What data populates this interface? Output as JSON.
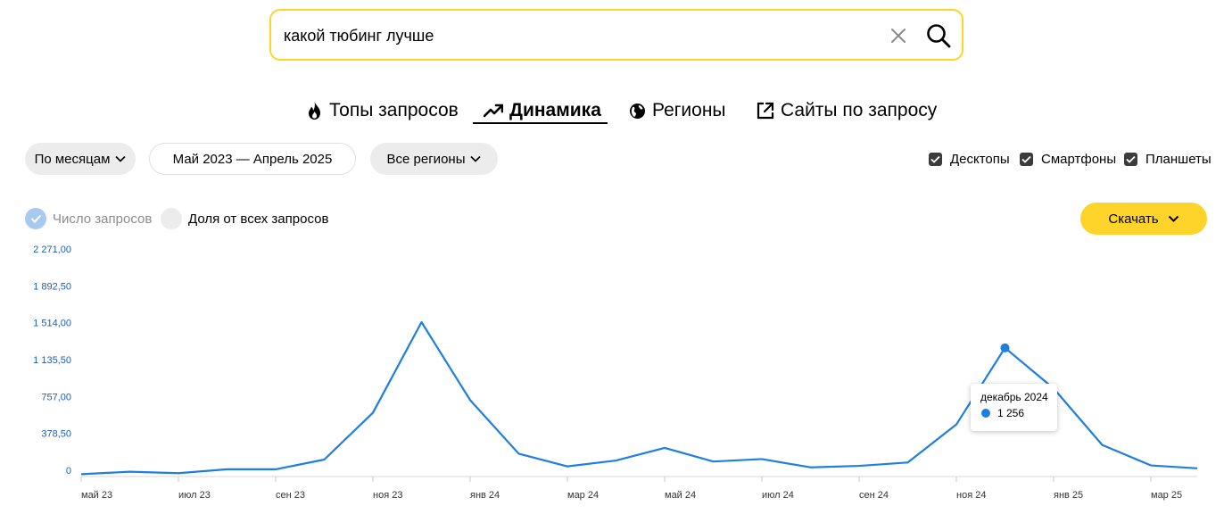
{
  "search": {
    "value": "какой тюбинг лучше"
  },
  "tabs": [
    {
      "label": "Топы запросов",
      "icon": "fire-icon"
    },
    {
      "label": "Динамика",
      "icon": "trend-up-icon",
      "active": true
    },
    {
      "label": "Регионы",
      "icon": "globe-icon"
    },
    {
      "label": "Сайты по запросу",
      "icon": "external-link-icon"
    }
  ],
  "filters": {
    "period_group": "По месяцам",
    "date_range": "Май 2023 — Апрель 2025",
    "region": "Все регионы"
  },
  "devices": [
    {
      "label": "Десктопы",
      "checked": true
    },
    {
      "label": "Смартфоны",
      "checked": true
    },
    {
      "label": "Планшеты",
      "checked": true
    }
  ],
  "metric": {
    "absolute_label": "Число запросов",
    "share_label": "Доля от всех запросов",
    "selected": "absolute"
  },
  "download": {
    "label": "Скачать"
  },
  "tooltip": {
    "title": "декабрь 2024",
    "value": "1 256"
  },
  "colors": {
    "accent": "#fed42b",
    "line": "#1e7fe0",
    "axis_text": "#1a5fb4"
  },
  "chart_data": {
    "type": "line",
    "yticks": [
      "2 271,00",
      "1 892,50",
      "1 514,00",
      "1 135,50",
      "757,00",
      "378,50",
      "0"
    ],
    "ylim": [
      0,
      2271
    ],
    "xticks": [
      "май 23",
      "июл 23",
      "сен 23",
      "ноя 23",
      "янв 24",
      "мар 24",
      "май 24",
      "июл 24",
      "сен 24",
      "ноя 24",
      "янв 25",
      "мар 25"
    ],
    "x": [
      "май 23",
      "июн 23",
      "июл 23",
      "авг 23",
      "сен 23",
      "окт 23",
      "ноя 23",
      "дек 23",
      "янв 24",
      "фев 24",
      "мар 24",
      "апр 24",
      "май 24",
      "июн 24",
      "июл 24",
      "авг 24",
      "сен 24",
      "окт 24",
      "ноя 24",
      "дек 24",
      "янв 25",
      "фев 25",
      "мар 25",
      "апр 25"
    ],
    "series": [
      {
        "values": [
          -40,
          -15,
          -30,
          10,
          10,
          110,
          590,
          1520,
          720,
          170,
          40,
          100,
          230,
          90,
          115,
          30,
          45,
          80,
          470,
          1256,
          840,
          260,
          50,
          20
        ]
      }
    ],
    "highlight_index": 19
  }
}
